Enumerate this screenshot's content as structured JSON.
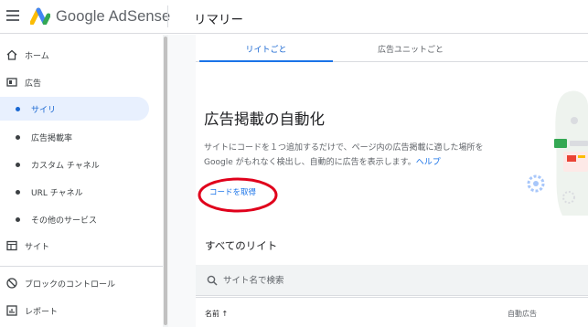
{
  "header": {
    "brand": "Google AdSense",
    "title": "リマリー"
  },
  "sidebar": {
    "items": [
      {
        "label": "ホーム",
        "icon": "home-icon"
      },
      {
        "label": "広告",
        "icon": "ads-icon"
      },
      {
        "label": "サイリ",
        "active": true
      },
      {
        "label": "広告掲載率"
      },
      {
        "label": "カスタム チャネル"
      },
      {
        "label": "URL チャネル"
      },
      {
        "label": "その他のサービス"
      },
      {
        "label": "サイト",
        "icon": "sites-icon"
      },
      {
        "label": "ブロックのコントロール",
        "icon": "block-icon"
      },
      {
        "label": "レポート",
        "icon": "report-icon"
      }
    ]
  },
  "tabs": [
    {
      "label": "リイトごと",
      "active": true
    },
    {
      "label": "広告ユニットごと",
      "active": false
    }
  ],
  "auto_ads": {
    "title": "広告掲載の自動化",
    "description": "サイトにコードを１つ追加するだけで、ページ内の広告掲載に適した場所を Google がもれなく検出し、自動的に広告を表示します。",
    "help_label": "ヘルプ",
    "button_label": "コードを取得"
  },
  "sites_section": {
    "title": "すべてのリイト",
    "search_placeholder": "サイト名で検索",
    "columns": {
      "name": "名前 ↑",
      "auto": "自動広告"
    }
  },
  "colors": {
    "accent": "#1a73e8",
    "active_bg": "#e8f0fe",
    "annotation": "#e0001b"
  }
}
